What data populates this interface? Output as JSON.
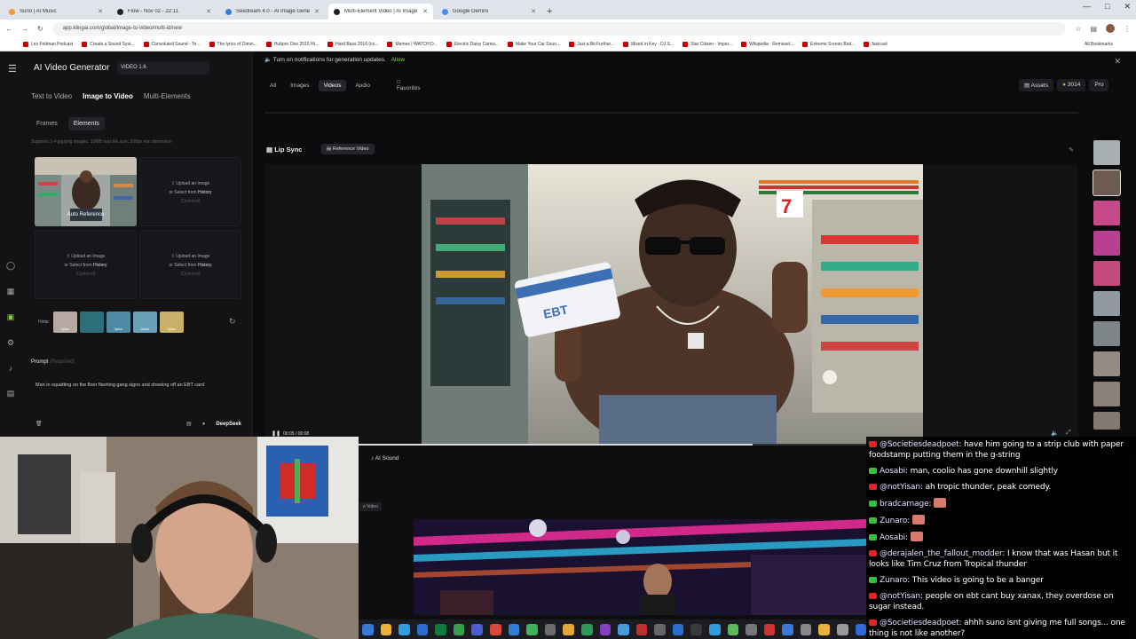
{
  "browser": {
    "tabs": [
      {
        "title": "Suno | AI Music",
        "color": "#f59a3a",
        "active": false
      },
      {
        "title": "Flow - Nov 02 - 22:11",
        "color": "#222222",
        "active": false
      },
      {
        "title": "Seedream 4.0 - AI Image Gene",
        "color": "#3a7bd5",
        "active": false
      },
      {
        "title": "Multi-Element Video | AI Image",
        "color": "#222222",
        "active": true
      },
      {
        "title": "Google Gemini",
        "color": "#4c8cf5",
        "active": false
      }
    ],
    "new_tab": "+",
    "url": "app.klingai.com/global/image-to-video/multi-id/new",
    "bookmarks": [
      "Lex Fridman Podcast",
      "Create a Sound Syst...",
      "Convoluted Sound - Te...",
      "The lyrics of Dimin...",
      "Hubpro One 2015 Ht...",
      "Hard Bass 2016 (co...",
      "Memes | WATCH D...",
      "Electric Daisy Carniv...",
      "Make Your Car Soun...",
      "Just a Bit Further...",
      "Mixed in Key - DJ S...",
      "Star Citizen - Impor...",
      "Wikipedia - Remixed...",
      "Extreme Screen Bed...",
      "fastcast"
    ],
    "all_bookmarks": "All Bookmarks"
  },
  "app": {
    "title": "AI Video Generator",
    "version": "VIDEO 1.6",
    "mode_tabs": [
      "Text to Video",
      "Image to Video",
      "Multi-Elements"
    ],
    "active_mode": "Image to Video",
    "sub_tabs": [
      "Frames",
      "Elements"
    ],
    "active_sub_tab": "Elements",
    "upload_hint": "Supports 1-4 jpg/png images: 10MB max file size, 300px min dimension",
    "auto_reference": "Auto Reference",
    "upload": {
      "line1": "Upload an Image",
      "line2_prefix": "or Select from",
      "line2_link": "History",
      "optional": "(Optional)"
    },
    "hints_label": "Hints:",
    "hint_thumbs": [
      {
        "label": "4pics",
        "color": "#b7a9a2"
      },
      {
        "label": "",
        "color": "#2c6f7a"
      },
      {
        "label": "3pics",
        "color": "#4f8aa5"
      },
      {
        "label": "2pics",
        "color": "#69a0b8"
      },
      {
        "label": "2pics",
        "color": "#c9b06a"
      }
    ],
    "prompt_title": "Prompt",
    "prompt_required": "(Required)",
    "prompt_text": "Man in squatting on the floor flashing gang signs and showing off an EBT card",
    "deepseek": "DeepSeek",
    "notification": "Turn on notifications for generation updates.",
    "notification_action": "Allow",
    "filters": [
      "All",
      "Images",
      "Videos",
      "Audio"
    ],
    "active_filter": "Videos",
    "favorites": "Favorites",
    "assets": "Assets",
    "credits": "3014",
    "pro": "Pro",
    "lip_sync": "Lip Sync",
    "reference_video": "Reference Video",
    "timecode": "00:05 / 00:08",
    "progress": 0.6,
    "ai_sound": "AI Sound",
    "lower_tag": "e Video",
    "ebt_card_text": "EBT"
  },
  "chat": [
    {
      "platform": "yt",
      "user": "@Societiesdeadpoet",
      "text": "have him going to a strip club with paper foodstamp putting them in the g-string"
    },
    {
      "platform": "g",
      "user": "Aosabi",
      "text": "man, coolio has gone downhill slightly"
    },
    {
      "platform": "yt",
      "user": "@notYisan",
      "text": "ah tropic thunder, peak comedy."
    },
    {
      "platform": "g",
      "user": "bradcarnage",
      "text": "",
      "emote": true
    },
    {
      "platform": "g",
      "user": "Zunaro",
      "text": "",
      "emote": true
    },
    {
      "platform": "g",
      "user": "Aosabi",
      "text": "",
      "emote": true
    },
    {
      "platform": "yt",
      "user": "@derajalen_the_fallout_modder",
      "text": "I know that was Hasan but it looks like Tim Cruz from Tropical thunder"
    },
    {
      "platform": "g",
      "user": "Zunaro",
      "text": "This video is going to be a banger"
    },
    {
      "platform": "yt",
      "user": "@notYisan",
      "text": "people on ebt cant buy xanax, they overdose on sugar instead."
    },
    {
      "platform": "yt",
      "user": "@Societiesdeadpoet",
      "text": "ahhh suno isnt giving me full songs... one thing is not like another?"
    }
  ],
  "taskbar_colors": [
    "#3a78d8",
    "#e8b23a",
    "#2f9be0",
    "#2c6cd1",
    "#0f7a3a",
    "#36a04e",
    "#4b5bd0",
    "#d8493a",
    "#2f7fd8",
    "#3fb35b",
    "#6b6b6b",
    "#e5a63a",
    "#2d9a55",
    "#8040c0",
    "#4a9ad8",
    "#c03030",
    "#666",
    "#2c6cd1",
    "#3a3a3a",
    "#2f9be0",
    "#5cb85c",
    "#777",
    "#c33",
    "#3a78d8",
    "#888",
    "#e8b23a",
    "#999",
    "#2c6cd1"
  ]
}
